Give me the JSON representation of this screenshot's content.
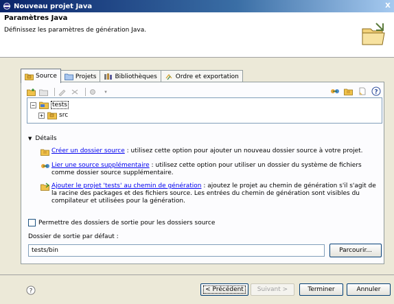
{
  "window": {
    "title": "Nouveau projet Java",
    "close": "X"
  },
  "header": {
    "title": "Paramètres Java",
    "description": "Définissez les paramètres de génération Java."
  },
  "tabs": [
    {
      "label": "Source",
      "icon": "package-folder-icon",
      "active": true
    },
    {
      "label": "Projets",
      "icon": "project-folder-icon",
      "active": false
    },
    {
      "label": "Bibliothèques",
      "icon": "library-icon",
      "active": false
    },
    {
      "label": "Ordre et exportation",
      "icon": "order-arrows-icon",
      "active": false
    }
  ],
  "tree": {
    "root": {
      "label": "tests",
      "expander": "−"
    },
    "child": {
      "label": "src",
      "expander": "+"
    }
  },
  "details": {
    "heading": "Détails",
    "items": [
      {
        "link": "Créer un dossier source",
        "text": " : utilisez cette option pour ajouter un nouveau dossier source à votre projet.",
        "icon": "new-source-folder-icon"
      },
      {
        "link": "Lier une source supplémentaire",
        "text": " : utilisez cette option pour utiliser un dossier du système de fichiers comme dossier source supplémentaire.",
        "icon": "link-source-icon"
      },
      {
        "link": "Ajouter le projet 'tests' au chemin de génération",
        "text": " : ajoutez le projet au chemin de génération s'il s'agit de la racine des packages et des fichiers source. Les entrées du chemin de génération sont visibles du compilateur et utilisées pour la génération.",
        "icon": "add-to-build-path-icon"
      }
    ]
  },
  "output": {
    "checkbox_label": "Permettre des dossiers de sortie pour les dossiers source",
    "checked": false,
    "default_label": "Dossier de sortie par défaut :",
    "value": "tests/bin",
    "browse_label": "Parcourir..."
  },
  "buttons": {
    "back": "< Précédent",
    "next": "Suivant >",
    "finish": "Terminer",
    "cancel": "Annuler",
    "help": "?"
  },
  "colors": {
    "link": "#0000ee",
    "titlebar": "#0a246a",
    "folder": "#e8b84a"
  }
}
